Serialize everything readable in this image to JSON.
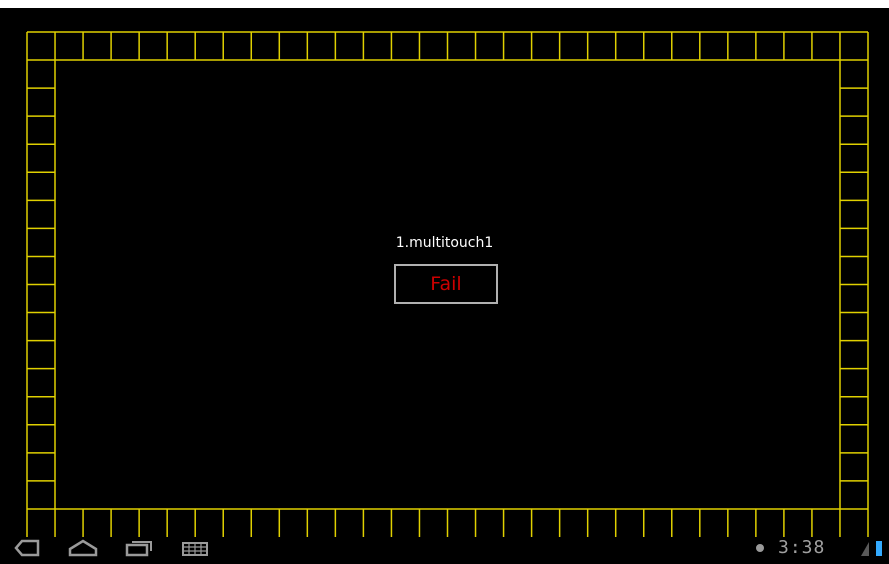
{
  "test": {
    "title": "1.multitouch1",
    "result": "Fail",
    "result_color": "#cc0000"
  },
  "grid": {
    "color": "#e0d000",
    "background": "#000000"
  },
  "statusbar": {
    "time": "3:38",
    "icons": [
      "back-icon",
      "home-icon",
      "recent-apps-icon",
      "keyboard-icon",
      "notification-dot-icon",
      "signal-icon",
      "battery-icon"
    ]
  }
}
